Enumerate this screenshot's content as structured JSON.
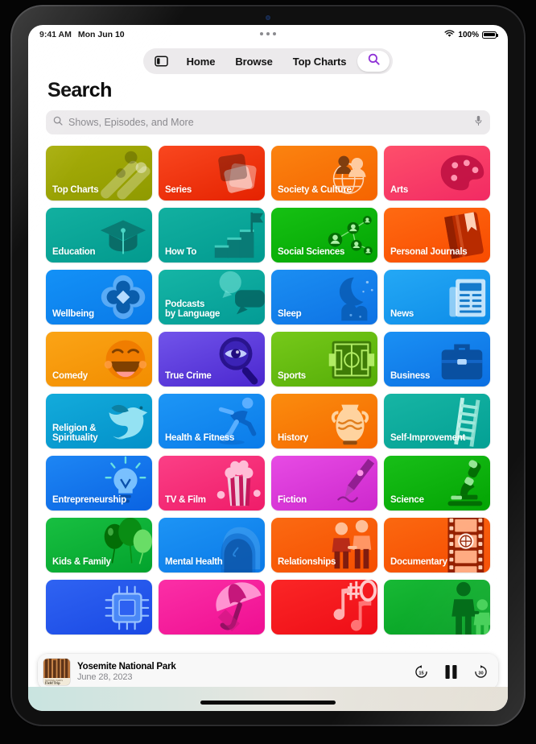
{
  "status_bar": {
    "time": "9:41 AM",
    "date": "Mon Jun 10",
    "wifi_icon": "wifi-icon",
    "battery_percent": "100%"
  },
  "nav": {
    "sidebar_toggle_icon": "sidebar-toggle-icon",
    "items": [
      {
        "label": "Home",
        "name": "nav-item-home"
      },
      {
        "label": "Browse",
        "name": "nav-item-browse"
      },
      {
        "label": "Top Charts",
        "name": "nav-item-top-charts"
      }
    ],
    "search_icon": "search-icon",
    "search_accent": "#8f33d6"
  },
  "page": {
    "title": "Search"
  },
  "search": {
    "value": "",
    "placeholder": "Shows, Episodes, and More",
    "icon": "search-icon",
    "mic_icon": "microphone-icon"
  },
  "categories": [
    {
      "label": "Top Charts",
      "art": "chart-bars-icon",
      "c1": "#a8ae09",
      "c2": "#8f9a00"
    },
    {
      "label": "Series",
      "art": "cards-stack-icon",
      "c1": "#f9471f",
      "c2": "#e52200"
    },
    {
      "label": "Society & Culture",
      "art": "globe-people-icon",
      "c1": "#fb8310",
      "c2": "#f56400"
    },
    {
      "label": "Arts",
      "art": "paint-palette-icon",
      "c1": "#fe4f6b",
      "c2": "#f22a63"
    },
    {
      "label": "Education",
      "art": "graduation-cap-icon",
      "c1": "#12b0a0",
      "c2": "#029a8e"
    },
    {
      "label": "How To",
      "art": "stairs-flag-icon",
      "c1": "#12b0a0",
      "c2": "#019a90"
    },
    {
      "label": "Social Sciences",
      "art": "network-people-icon",
      "c1": "#16c113",
      "c2": "#03a503"
    },
    {
      "label": "Personal Journals",
      "art": "book-bookmark-icon",
      "c1": "#ff6a12",
      "c2": "#f84b00"
    },
    {
      "label": "Wellbeing",
      "art": "flower-bloom-icon",
      "c1": "#1391f7",
      "c2": "#0a7ae8"
    },
    {
      "label": "Podcasts\nby Language",
      "art": "speech-bubbles-icon",
      "c1": "#15b5a5",
      "c2": "#039b95"
    },
    {
      "label": "Sleep",
      "art": "moon-cloud-icon",
      "c1": "#1b8ef2",
      "c2": "#0d72e4"
    },
    {
      "label": "News",
      "art": "newspaper-icon",
      "c1": "#24a8f5",
      "c2": "#0d8ce8"
    },
    {
      "label": "Comedy",
      "art": "smiling-face-icon",
      "c1": "#fba416",
      "c2": "#f28d00"
    },
    {
      "label": "True Crime",
      "art": "magnifier-eye-icon",
      "c1": "#7154ea",
      "c2": "#4b27cf"
    },
    {
      "label": "Sports",
      "art": "soccer-field-icon",
      "c1": "#76c91a",
      "c2": "#55ad07"
    },
    {
      "label": "Business",
      "art": "briefcase-icon",
      "c1": "#1a90f4",
      "c2": "#0b6fe2"
    },
    {
      "label": "Religion &\nSpirituality",
      "art": "dove-icon",
      "c1": "#13abdb",
      "c2": "#0391c9"
    },
    {
      "label": "Health & Fitness",
      "art": "runner-icon",
      "c1": "#1d96f6",
      "c2": "#0a7be9"
    },
    {
      "label": "History",
      "art": "amphora-vase-icon",
      "c1": "#fb8c0e",
      "c2": "#f56a00"
    },
    {
      "label": "Self-Improvement",
      "art": "ladder-icon",
      "c1": "#17b5a4",
      "c2": "#03a094"
    },
    {
      "label": "Entrepreneurship",
      "art": "lightbulb-icon",
      "c1": "#1d86f4",
      "c2": "#0a63e2"
    },
    {
      "label": "TV & Film",
      "art": "popcorn-icon",
      "c1": "#fb3f86",
      "c2": "#ef1c69"
    },
    {
      "label": "Fiction",
      "art": "fountain-pen-icon",
      "c1": "#e74be4",
      "c2": "#cd28cd"
    },
    {
      "label": "Science",
      "art": "microscope-icon",
      "c1": "#18bf18",
      "c2": "#03a403"
    },
    {
      "label": "Kids & Family",
      "art": "balloons-icon",
      "c1": "#18bf41",
      "c2": "#03a32d"
    },
    {
      "label": "Mental Health",
      "art": "head-profile-icon",
      "c1": "#1d94f5",
      "c2": "#0a79e7"
    },
    {
      "label": "Relationships",
      "art": "two-people-icon",
      "c1": "#fb6a12",
      "c2": "#f54e00"
    },
    {
      "label": "Documentary",
      "art": "film-strip-icon",
      "c1": "#fb6810",
      "c2": "#f54b00"
    },
    {
      "label": "",
      "art": "microchip-icon",
      "c1": "#2f63f2",
      "c2": "#1a49e4"
    },
    {
      "label": "",
      "art": "umbrella-icon",
      "c1": "#fb2fa6",
      "c2": "#ef0f92"
    },
    {
      "label": "",
      "art": "music-notes-icon",
      "c1": "#fb2626",
      "c2": "#ee0d17"
    },
    {
      "label": "",
      "art": "parent-child-icon",
      "c1": "#18b935",
      "c2": "#039e22"
    }
  ],
  "now_playing": {
    "artwork_name": "podcast-artwork-field-trip",
    "artwork_caption": "Field Trip",
    "title": "Yosemite National Park",
    "subtitle": "June 28, 2023",
    "skip_back_label": "15",
    "skip_forward_label": "30",
    "skip_back_icon": "skip-back-15-icon",
    "play_pause_icon": "pause-icon",
    "skip_forward_icon": "skip-forward-30-icon"
  }
}
